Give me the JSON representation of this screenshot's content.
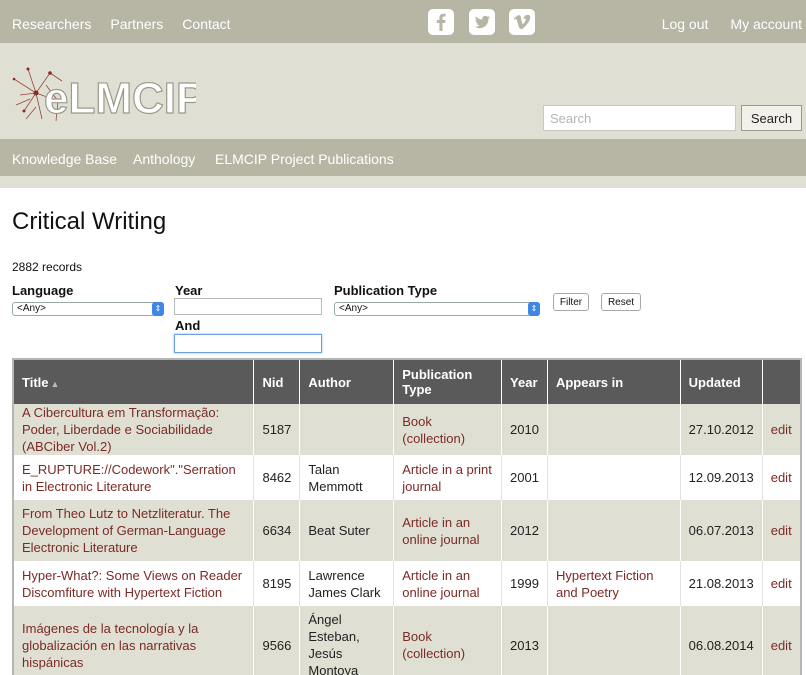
{
  "topnav": {
    "researchers": "Researchers",
    "partners": "Partners",
    "contact": "Contact"
  },
  "social": {
    "facebook": "facebook-icon",
    "twitter": "twitter-icon",
    "vimeo": "vimeo-icon"
  },
  "account": {
    "logout": "Log out",
    "my_account": "My account"
  },
  "logo": {
    "text": "eLMCIP"
  },
  "search": {
    "placeholder": "Search",
    "button": "Search"
  },
  "subnav": {
    "knowledge_base": "Knowledge Base",
    "anthology": "Anthology",
    "project_publications": "ELMCIP Project Publications"
  },
  "page": {
    "title": "Critical Writing",
    "records": "2882 records"
  },
  "filters": {
    "language_label": "Language",
    "language_value": "<Any>",
    "year_label": "Year",
    "and_label": "And",
    "pubtype_label": "Publication Type",
    "pubtype_value": "<Any>",
    "filter_button": "Filter",
    "reset_button": "Reset"
  },
  "table": {
    "headers": {
      "title": "Title",
      "nid": "Nid",
      "author": "Author",
      "pubtype": "Publication Type",
      "year": "Year",
      "appears_in": "Appears in",
      "updated": "Updated"
    },
    "rows": [
      {
        "title": "A Cibercultura em Transformação: Poder, Liberdade e Sociabilidade (ABCiber Vol.2)",
        "nid": "5187",
        "author": "",
        "pubtype": "Book (collection)",
        "year": "2010",
        "appears_in": "",
        "updated": "27.10.2012",
        "edit": "edit"
      },
      {
        "title": "E_RUPTURE://Codework\".\"Serration in Electronic Literature",
        "nid": "8462",
        "author": "Talan Memmott",
        "pubtype": "Article in a print journal",
        "year": "2001",
        "appears_in": "",
        "updated": "12.09.2013",
        "edit": "edit"
      },
      {
        "title": "From Theo Lutz to Netzliteratur. The Development of German-Language Electronic Literature",
        "nid": "6634",
        "author": "Beat Suter",
        "pubtype": "Article in an online journal",
        "year": "2012",
        "appears_in": "",
        "updated": "06.07.2013",
        "edit": "edit"
      },
      {
        "title": "Hyper-What?: Some Views on Reader Discomfiture with Hypertext Fiction",
        "nid": "8195",
        "author": "Lawrence James Clark",
        "pubtype": "Article in an online journal",
        "year": "1999",
        "appears_in": "Hypertext Fiction and Poetry",
        "updated": "21.08.2013",
        "edit": "edit"
      },
      {
        "title": "Imágenes de la tecnología y la globalización en las narrativas hispánicas",
        "nid": "9566",
        "author": "Ángel Esteban, Jesús Montoya",
        "pubtype": "Book (collection)",
        "year": "2013",
        "appears_in": "",
        "updated": "06.08.2014",
        "edit": "edit"
      }
    ]
  },
  "colors": {
    "topbar": "#b7b6a5",
    "header_bg": "#dfe0d3",
    "link": "#7b2a26",
    "table_header": "#5a5a5a"
  }
}
